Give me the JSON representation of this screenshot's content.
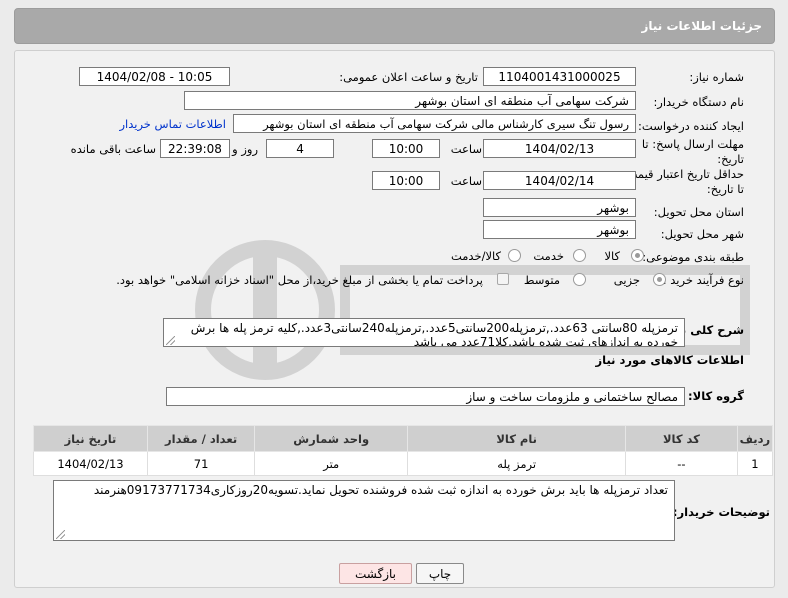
{
  "header": {
    "title": "جزئیات اطلاعات نیاز"
  },
  "fields": {
    "need_number_label": "شماره نیاز:",
    "need_number": "1104001431000025",
    "announce_label": "تاریخ و ساعت اعلان عمومی:",
    "announce_value": "1404/02/08 - 10:05",
    "buyer_org_label": "نام دستگاه خریدار:",
    "buyer_org": "شرکت سهامی آب منطقه ای استان بوشهر",
    "creator_label": "ایجاد کننده درخواست:",
    "creator": "رسول تنگ سیری کارشناس مالی شرکت سهامی آب منطقه ای استان بوشهر",
    "buyer_contact_link": "اطلاعات تماس خریدار",
    "reply_deadline_label_1": "مهلت ارسال پاسخ: تا",
    "reply_deadline_label_2": "تاریخ:",
    "reply_date": "1404/02/13",
    "time_label": "ساعت",
    "reply_time": "10:00",
    "days_count": "4",
    "days_label": "روز و",
    "remaining_time": "22:39:08",
    "remaining_label": "ساعت باقی مانده",
    "price_validity_label_1": "حداقل تاریخ اعتبار قیمت:",
    "price_validity_label_2": "تا تاریخ:",
    "price_date": "1404/02/14",
    "price_time": "10:00",
    "province_label": "استان محل تحویل:",
    "province": "بوشهر",
    "city_label": "شهر محل تحویل:",
    "city": "بوشهر",
    "category_label": "طبقه بندی موضوعی:",
    "category_options": [
      "کالا",
      "خدمت",
      "کالا/خدمت"
    ],
    "purchase_type_label": "نوع فرآیند خرید :",
    "purchase_type_options": [
      "جزیی",
      "متوسط"
    ],
    "payment_note": "پرداخت تمام یا بخشی از مبلغ خرید،از محل \"اسناد خزانه اسلامی\" خواهد بود.",
    "description_label": "شرح کلی نیاز:",
    "description": "ترمزپله 80سانتی 63عدد.,ترمزپله200سانتی5عدد.,ترمزپله240سانتی3عدد.,کلیه ترمز پله ها برش خورده به اندازهای ثبت شده باشد.کلا71عدد می باشد"
  },
  "goods": {
    "section_title": "اطلاعات کالاهای مورد نیاز",
    "group_label": "گروه کالا:",
    "group_value": "مصالح ساختمانی و ملزومات ساخت و ساز",
    "columns": [
      "ردیف",
      "کد کالا",
      "نام کالا",
      "واحد شمارش",
      "تعداد / مقدار",
      "تاریخ نیاز"
    ],
    "rows": [
      {
        "index": "1",
        "code": "--",
        "name": "ترمز پله",
        "unit": "متر",
        "qty": "71",
        "date": "1404/02/13"
      }
    ]
  },
  "buyer_notes": {
    "label": "توضیحات خریدار:",
    "text": "تعداد ترمزپله ها باید برش خورده به اندازه ثبت شده فروشنده تحویل نماید.تسویه20روزکاری09173771734هنرمند"
  },
  "buttons": {
    "print": "چاپ",
    "back": "بازگشت"
  },
  "colors": {
    "header": "#a9a9a9",
    "link": "#0033cc"
  }
}
